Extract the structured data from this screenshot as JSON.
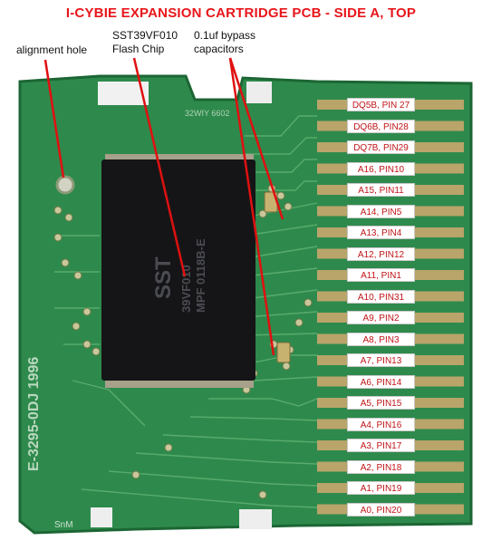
{
  "title": "I-CYBIE EXPANSION CARTRIDGE PCB - SIDE A, TOP",
  "callouts": {
    "alignment_hole": "alignment hole",
    "flash_chip": "SST39VF010\nFlash Chip",
    "bypass_caps": "0.1uf bypass\ncapacitors"
  },
  "pins": [
    "DQ5B, PIN 27",
    "DQ6B, PIN28",
    "DQ7B, PIN29",
    "A16, PIN10",
    "A15, PIN11",
    "A14, PIN5",
    "A13, PIN4",
    "A12, PIN12",
    "A11, PIN1",
    "A10, PIN31",
    "A9, PIN2",
    "A8, PIN3",
    "A7, PIN13",
    "A6, PIN14",
    "A5, PIN15",
    "A4, PIN16",
    "A3, PIN17",
    "A2, PIN18",
    "A1, PIN19",
    "A0, PIN20"
  ],
  "colors": {
    "title": "#e8161b",
    "callout_line": "#e01010",
    "pcb_green": "#2e8a4c",
    "pad_gold": "#b9a46a",
    "chip": "#151517"
  },
  "chip_marking": {
    "brand": "SST",
    "part": "39VF010",
    "code": "MPF 0118B-E"
  },
  "silkscreen": {
    "left_text": "E-3295-0DJ 1996",
    "top_text": "32WIY   6602",
    "bottom_text": "SnM"
  }
}
